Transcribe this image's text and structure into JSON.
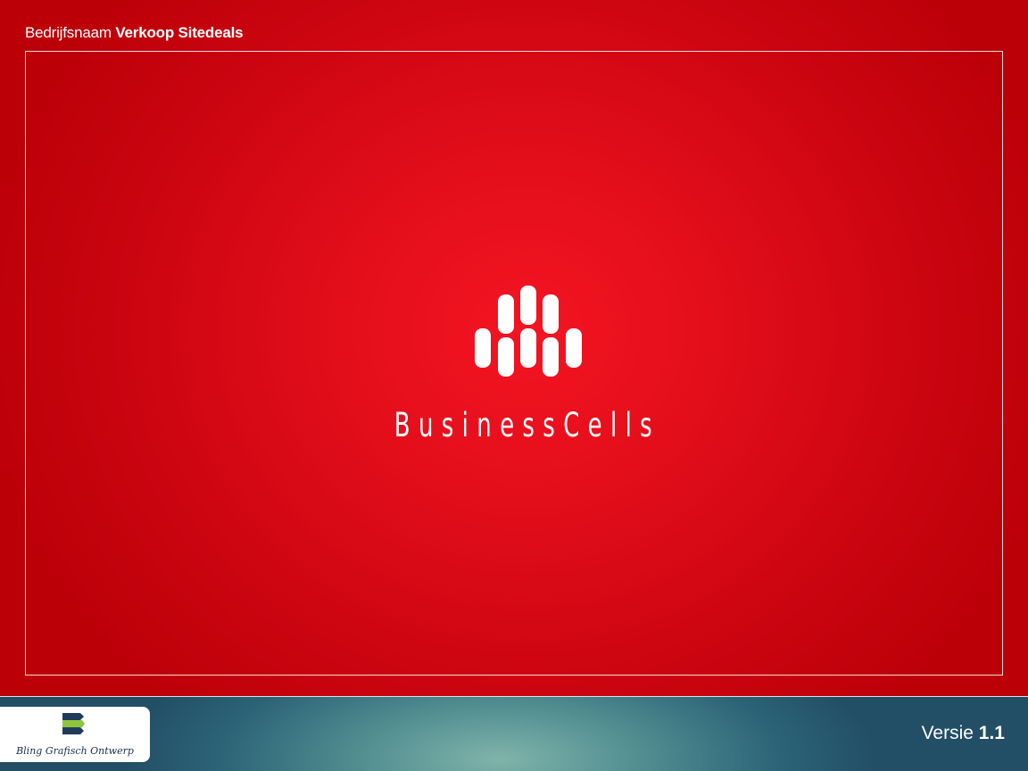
{
  "header": {
    "prefix": "Bedrijfsnaam",
    "company": "Verkoop Sitedeals"
  },
  "logo": {
    "icon": "business-cells-icon",
    "text": "BusinessCells"
  },
  "footer": {
    "brand_icon": "bling-logo-icon",
    "brand_name": "Bling Grafisch Ontwerp",
    "version_label": "Versie",
    "version_number": "1.1"
  },
  "colors": {
    "background_red": "#e20e1a",
    "footer_teal": "#4f8b8f",
    "text": "#ffffff"
  }
}
